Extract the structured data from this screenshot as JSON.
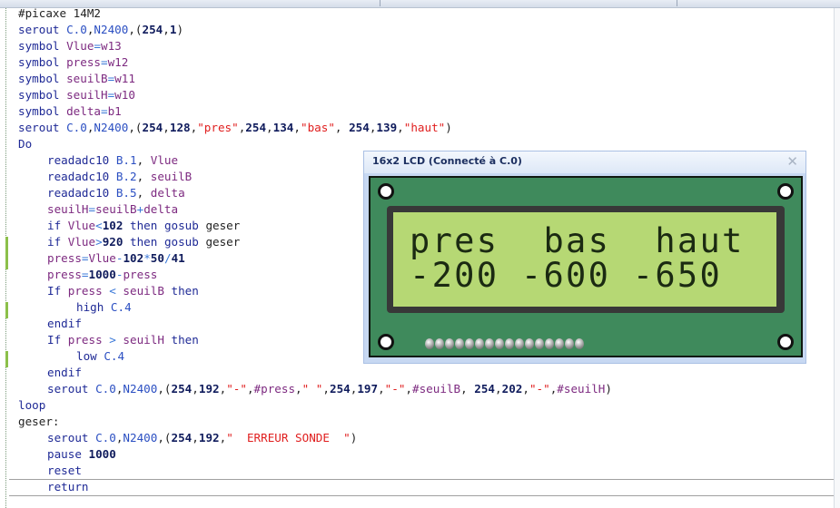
{
  "editor": {
    "lines": [
      {
        "indent": 0,
        "tokens": [
          [
            "#picaxe 14M2",
            "p"
          ]
        ]
      },
      {
        "indent": 0,
        "tokens": [
          [
            "serout ",
            "k"
          ],
          [
            "C.0",
            "c"
          ],
          [
            ",",
            "p"
          ],
          [
            "N2400",
            "c"
          ],
          [
            ",(",
            "p"
          ],
          [
            "254",
            "n"
          ],
          [
            ",",
            "p"
          ],
          [
            "1",
            "n"
          ],
          [
            ")",
            "p"
          ]
        ]
      },
      {
        "indent": 0,
        "tokens": [
          [
            "symbol ",
            "k"
          ],
          [
            "Vlue",
            "v"
          ],
          [
            "=",
            "o"
          ],
          [
            "w13",
            "v"
          ]
        ]
      },
      {
        "indent": 0,
        "tokens": [
          [
            "symbol ",
            "k"
          ],
          [
            "press",
            "v"
          ],
          [
            "=",
            "o"
          ],
          [
            "w12",
            "v"
          ]
        ]
      },
      {
        "indent": 0,
        "tokens": [
          [
            "symbol ",
            "k"
          ],
          [
            "seuilB",
            "v"
          ],
          [
            "=",
            "o"
          ],
          [
            "w11",
            "v"
          ]
        ]
      },
      {
        "indent": 0,
        "tokens": [
          [
            "symbol ",
            "k"
          ],
          [
            "seuilH",
            "v"
          ],
          [
            "=",
            "o"
          ],
          [
            "w10",
            "v"
          ]
        ]
      },
      {
        "indent": 0,
        "tokens": [
          [
            "symbol ",
            "k"
          ],
          [
            "delta",
            "v"
          ],
          [
            "=",
            "o"
          ],
          [
            "b1",
            "v"
          ]
        ]
      },
      {
        "indent": 0,
        "tokens": [
          [
            "serout ",
            "k"
          ],
          [
            "C.0",
            "c"
          ],
          [
            ",",
            "p"
          ],
          [
            "N2400",
            "c"
          ],
          [
            ",(",
            "p"
          ],
          [
            "254",
            "n"
          ],
          [
            ",",
            "p"
          ],
          [
            "128",
            "n"
          ],
          [
            ",",
            "p"
          ],
          [
            "\"pres\"",
            "s"
          ],
          [
            ",",
            "p"
          ],
          [
            "254",
            "n"
          ],
          [
            ",",
            "p"
          ],
          [
            "134",
            "n"
          ],
          [
            ",",
            "p"
          ],
          [
            "\"bas\"",
            "s"
          ],
          [
            ", ",
            "p"
          ],
          [
            "254",
            "n"
          ],
          [
            ",",
            "p"
          ],
          [
            "139",
            "n"
          ],
          [
            ",",
            "p"
          ],
          [
            "\"haut\"",
            "s"
          ],
          [
            ")",
            "p"
          ]
        ]
      },
      {
        "indent": 0,
        "tokens": [
          [
            "Do",
            "k"
          ]
        ]
      },
      {
        "indent": 1,
        "tokens": [
          [
            "readadc10 ",
            "k"
          ],
          [
            "B.1",
            "c"
          ],
          [
            ", ",
            "p"
          ],
          [
            "Vlue",
            "v"
          ]
        ]
      },
      {
        "indent": 1,
        "tokens": [
          [
            "readadc10 ",
            "k"
          ],
          [
            "B.2",
            "c"
          ],
          [
            ", ",
            "p"
          ],
          [
            "seuilB",
            "v"
          ]
        ]
      },
      {
        "indent": 1,
        "tokens": [
          [
            "readadc10 ",
            "k"
          ],
          [
            "B.5",
            "c"
          ],
          [
            ", ",
            "p"
          ],
          [
            "delta",
            "v"
          ]
        ]
      },
      {
        "indent": 1,
        "tokens": [
          [
            "seuilH",
            "v"
          ],
          [
            "=",
            "o"
          ],
          [
            "seuilB",
            "v"
          ],
          [
            "+",
            "o"
          ],
          [
            "delta",
            "v"
          ]
        ]
      },
      {
        "indent": 1,
        "tokens": [
          [
            "if ",
            "k"
          ],
          [
            "Vlue",
            "v"
          ],
          [
            "<",
            "o"
          ],
          [
            "102",
            "n"
          ],
          [
            " then ",
            "k"
          ],
          [
            "gosub ",
            "k"
          ],
          [
            "geser",
            "p"
          ]
        ]
      },
      {
        "indent": 1,
        "mark": true,
        "tokens": [
          [
            "if ",
            "k"
          ],
          [
            "Vlue",
            "v"
          ],
          [
            ">",
            "o"
          ],
          [
            "920",
            "n"
          ],
          [
            " then ",
            "k"
          ],
          [
            "gosub ",
            "k"
          ],
          [
            "geser",
            "p"
          ]
        ]
      },
      {
        "indent": 1,
        "mark": true,
        "tokens": [
          [
            "press",
            "v"
          ],
          [
            "=",
            "o"
          ],
          [
            "Vlue",
            "v"
          ],
          [
            "-",
            "o"
          ],
          [
            "102",
            "n"
          ],
          [
            "*",
            "o"
          ],
          [
            "50",
            "n"
          ],
          [
            "/",
            "o"
          ],
          [
            "41",
            "n"
          ]
        ]
      },
      {
        "indent": 1,
        "tokens": [
          [
            "press",
            "v"
          ],
          [
            "=",
            "o"
          ],
          [
            "1000",
            "n"
          ],
          [
            "-",
            "o"
          ],
          [
            "press",
            "v"
          ]
        ]
      },
      {
        "indent": 1,
        "tokens": [
          [
            "If ",
            "k"
          ],
          [
            "press ",
            "v"
          ],
          [
            "< ",
            "o"
          ],
          [
            "seuilB ",
            "v"
          ],
          [
            "then",
            "k"
          ]
        ]
      },
      {
        "indent": 2,
        "mark": true,
        "tokens": [
          [
            "high ",
            "k"
          ],
          [
            "C.4",
            "c"
          ]
        ]
      },
      {
        "indent": 1,
        "tokens": [
          [
            "endif",
            "k"
          ]
        ]
      },
      {
        "indent": 1,
        "tokens": [
          [
            "If ",
            "k"
          ],
          [
            "press ",
            "v"
          ],
          [
            "> ",
            "o"
          ],
          [
            "seuilH ",
            "v"
          ],
          [
            "then",
            "k"
          ]
        ]
      },
      {
        "indent": 2,
        "mark": true,
        "tokens": [
          [
            "low ",
            "k"
          ],
          [
            "C.4",
            "c"
          ]
        ]
      },
      {
        "indent": 1,
        "tokens": [
          [
            "endif",
            "k"
          ]
        ]
      },
      {
        "indent": 1,
        "tokens": [
          [
            "serout ",
            "k"
          ],
          [
            "C.0",
            "c"
          ],
          [
            ",",
            "p"
          ],
          [
            "N2400",
            "c"
          ],
          [
            ",(",
            "p"
          ],
          [
            "254",
            "n"
          ],
          [
            ",",
            "p"
          ],
          [
            "192",
            "n"
          ],
          [
            ",",
            "p"
          ],
          [
            "\"-\"",
            "s"
          ],
          [
            ",",
            "p"
          ],
          [
            "#press",
            "v"
          ],
          [
            ",",
            "p"
          ],
          [
            "\" \"",
            "s"
          ],
          [
            ",",
            "p"
          ],
          [
            "254",
            "n"
          ],
          [
            ",",
            "p"
          ],
          [
            "197",
            "n"
          ],
          [
            ",",
            "p"
          ],
          [
            "\"-\"",
            "s"
          ],
          [
            ",",
            "p"
          ],
          [
            "#seuilB",
            "v"
          ],
          [
            ", ",
            "p"
          ],
          [
            "254",
            "n"
          ],
          [
            ",",
            "p"
          ],
          [
            "202",
            "n"
          ],
          [
            ",",
            "p"
          ],
          [
            "\"-\"",
            "s"
          ],
          [
            ",",
            "p"
          ],
          [
            "#seuilH",
            "v"
          ],
          [
            ")",
            "p"
          ]
        ]
      },
      {
        "indent": 0,
        "tokens": [
          [
            "loop",
            "k"
          ]
        ]
      },
      {
        "indent": 0,
        "tokens": [
          [
            "geser:",
            "p"
          ]
        ]
      },
      {
        "indent": 1,
        "tokens": [
          [
            "serout ",
            "k"
          ],
          [
            "C.0",
            "c"
          ],
          [
            ",",
            "p"
          ],
          [
            "N2400",
            "c"
          ],
          [
            ",(",
            "p"
          ],
          [
            "254",
            "n"
          ],
          [
            ",",
            "p"
          ],
          [
            "192",
            "n"
          ],
          [
            ",",
            "p"
          ],
          [
            "\"  ERREUR SONDE  \"",
            "s"
          ],
          [
            ")",
            "p"
          ]
        ]
      },
      {
        "indent": 1,
        "tokens": [
          [
            "pause ",
            "k"
          ],
          [
            "1000",
            "n"
          ]
        ]
      },
      {
        "indent": 1,
        "tokens": [
          [
            "reset",
            "k"
          ]
        ]
      },
      {
        "indent": 1,
        "tokens": [
          [
            "return",
            "k"
          ]
        ]
      }
    ]
  },
  "lcd": {
    "title": "16x2 LCD (Connecté à C.0)",
    "close_icon": "close-icon",
    "row1": "pres  bas  haut",
    "row2": "-200 -600 -650",
    "screen_color": "#b6d874",
    "board_color": "#3f8a5c"
  }
}
